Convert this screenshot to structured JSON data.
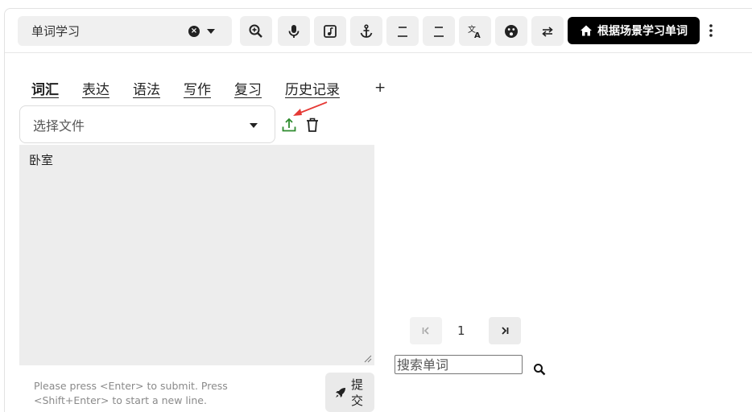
{
  "toolbar": {
    "mode_select": {
      "value": "单词学习"
    },
    "buttons": [
      {
        "name": "zoom-in"
      },
      {
        "name": "microphone"
      },
      {
        "name": "music-note"
      },
      {
        "name": "anchor"
      },
      {
        "name": "line-a"
      },
      {
        "name": "line-b"
      },
      {
        "name": "translate"
      },
      {
        "name": "emoji"
      },
      {
        "name": "swap"
      }
    ],
    "scene_button_label": "根据场景学习单词"
  },
  "tabs": [
    {
      "label": "词汇",
      "active": true
    },
    {
      "label": "表达",
      "active": false
    },
    {
      "label": "语法",
      "active": false
    },
    {
      "label": "写作",
      "active": false
    },
    {
      "label": "复习",
      "active": false
    },
    {
      "label": "历史记录",
      "active": false
    }
  ],
  "tab_add_label": "+",
  "file": {
    "placeholder": "选择文件"
  },
  "editor": {
    "text": "卧室"
  },
  "hint": "Please press <Enter> to submit. Press <Shift+Enter> to start a new line.",
  "submit_label": "提交",
  "pagination": {
    "current_page": "1"
  },
  "search": {
    "placeholder": "搜索单词"
  },
  "colors": {
    "upload_green": "#2e8b2e",
    "annotation_red": "#e53935",
    "scene_button_bg": "#000000"
  }
}
